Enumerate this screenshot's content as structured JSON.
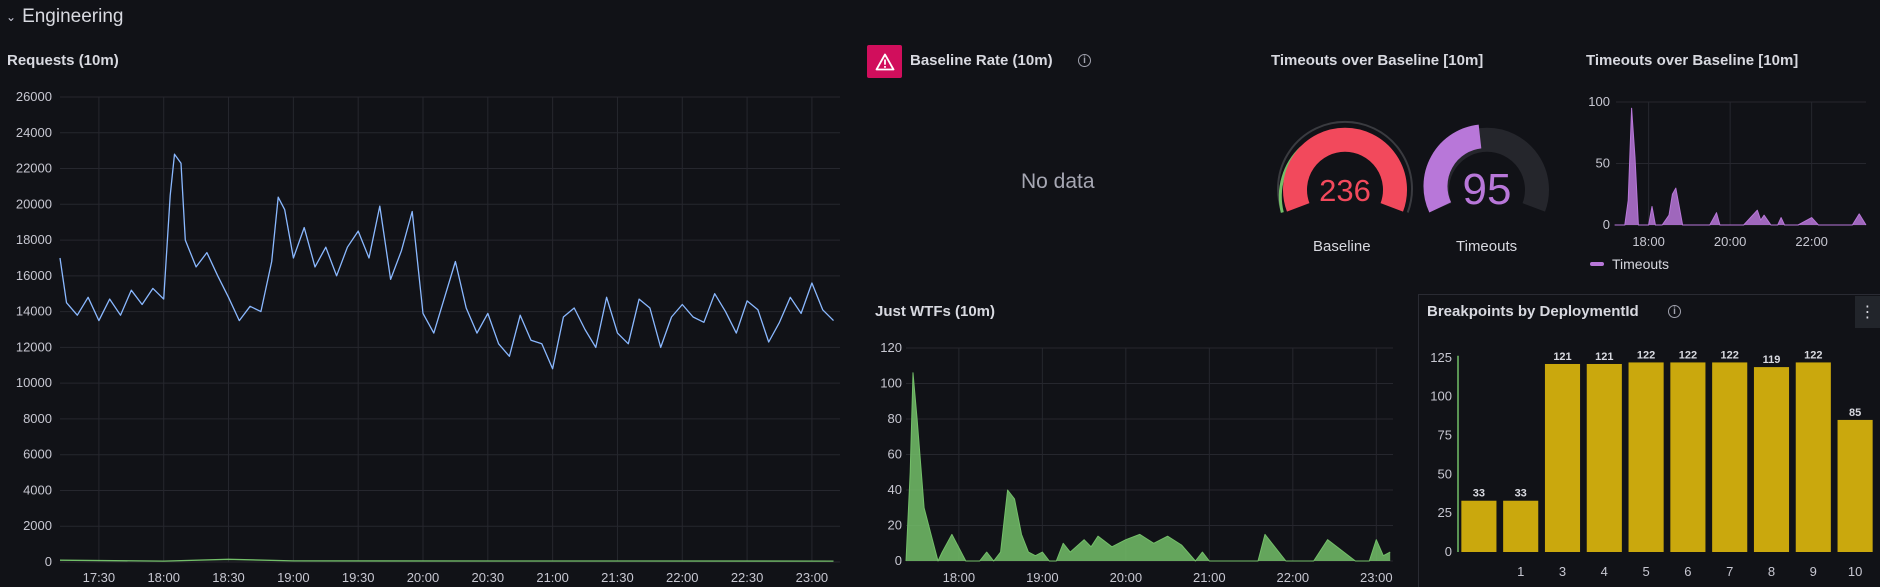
{
  "row": {
    "chevron": "⌄",
    "title": "Engineering"
  },
  "colors": {
    "background": "#111217",
    "line_blue": "#8ab8ff",
    "line_green": "#73bf69",
    "gauge_red": "#f2495c",
    "gauge_purple": "#b877d9",
    "bar_yellow": "#caa80d",
    "alert_pink": "#d10e5c"
  },
  "requests": {
    "title": "Requests (10m)",
    "chart_data": {
      "type": "line",
      "title": "Requests (10m)",
      "ylim": [
        0,
        26000
      ],
      "y_ticks": [
        "26000",
        "24000",
        "22000",
        "20000",
        "18000",
        "16000",
        "14000",
        "12000",
        "10000",
        "8000",
        "6000",
        "4000",
        "2000",
        "0"
      ],
      "x_ticks": [
        "17:30",
        "18:00",
        "18:30",
        "19:00",
        "19:30",
        "20:00",
        "20:30",
        "21:00",
        "21:30",
        "22:00",
        "22:30",
        "23:00"
      ],
      "series": [
        {
          "color": "#8ab8ff",
          "x": [
            "17:12",
            "17:15",
            "17:20",
            "17:25",
            "17:30",
            "17:35",
            "17:40",
            "17:45",
            "17:50",
            "17:55",
            "18:00",
            "18:03",
            "18:05",
            "18:08",
            "18:10",
            "18:15",
            "18:20",
            "18:25",
            "18:30",
            "18:35",
            "18:40",
            "18:45",
            "18:50",
            "18:53",
            "18:56",
            "19:00",
            "19:05",
            "19:10",
            "19:15",
            "19:20",
            "19:25",
            "19:30",
            "19:35",
            "19:40",
            "19:45",
            "19:50",
            "19:55",
            "20:00",
            "20:05",
            "20:10",
            "20:15",
            "20:20",
            "20:25",
            "20:30",
            "20:35",
            "20:40",
            "20:45",
            "20:50",
            "20:55",
            "21:00",
            "21:05",
            "21:10",
            "21:15",
            "21:20",
            "21:25",
            "21:30",
            "21:35",
            "21:40",
            "21:45",
            "21:50",
            "21:55",
            "22:00",
            "22:05",
            "22:10",
            "22:15",
            "22:20",
            "22:25",
            "22:30",
            "22:35",
            "22:40",
            "22:45",
            "22:50",
            "22:55",
            "23:00",
            "23:05",
            "23:10"
          ],
          "y": [
            17000,
            14500,
            13800,
            14800,
            13500,
            14700,
            13800,
            15200,
            14400,
            15300,
            14700,
            20500,
            22800,
            22300,
            18000,
            16500,
            17300,
            16000,
            14800,
            13500,
            14300,
            14000,
            16800,
            20400,
            19700,
            17000,
            18700,
            16500,
            17600,
            16000,
            17600,
            18500,
            17000,
            19900,
            15800,
            17400,
            19600,
            13900,
            12800,
            14800,
            16800,
            14200,
            12800,
            13900,
            12200,
            11500,
            13800,
            12400,
            12200,
            10800,
            13700,
            14200,
            13000,
            12000,
            14800,
            12800,
            12200,
            14700,
            14200,
            12000,
            13700,
            14400,
            13700,
            13400,
            15000,
            14000,
            12800,
            14600,
            14100,
            12300,
            13400,
            14800,
            13900,
            15600,
            14100,
            13500
          ]
        },
        {
          "color": "#73bf69",
          "x": [
            "17:12",
            "18:00",
            "18:30",
            "19:00",
            "23:10"
          ],
          "y": [
            100,
            50,
            150,
            60,
            50
          ]
        }
      ]
    }
  },
  "baseline": {
    "title": "Baseline Rate (10m)",
    "alert_icon": "warning-triangle-icon",
    "info_icon": "info-icon",
    "info_glyph": "i",
    "no_data": "No data"
  },
  "gauges": {
    "title": "Timeouts over Baseline [10m]",
    "chart_data": [
      {
        "type": "gauge",
        "label": "Baseline",
        "value": 236,
        "color": "#f2495c",
        "fill_fraction": 1.0
      },
      {
        "type": "gauge",
        "label": "Timeouts",
        "value": 95,
        "color": "#b877d9",
        "fill_fraction": 0.4
      }
    ]
  },
  "timeouts": {
    "title": "Timeouts over Baseline [10m]",
    "legend": "Timeouts",
    "chart_data": {
      "type": "area",
      "ylim": [
        0,
        100
      ],
      "y_ticks": [
        "100",
        "50",
        "0"
      ],
      "x_ticks": [
        "18:00",
        "20:00",
        "22:00"
      ],
      "series": [
        {
          "name": "Timeouts",
          "color": "#b877d9",
          "x": [
            "17:10",
            "17:25",
            "17:30",
            "17:35",
            "17:40",
            "17:45",
            "17:50",
            "17:55",
            "18:00",
            "18:05",
            "18:10",
            "18:20",
            "18:30",
            "18:35",
            "18:40",
            "18:45",
            "18:50",
            "19:00",
            "19:30",
            "19:40",
            "19:45",
            "20:00",
            "20:20",
            "20:30",
            "20:40",
            "20:45",
            "20:50",
            "21:00",
            "21:10",
            "21:15",
            "21:20",
            "21:30",
            "21:40",
            "22:00",
            "22:10",
            "22:20",
            "22:30",
            "22:40",
            "23:00",
            "23:10",
            "23:20"
          ],
          "y": [
            0,
            0,
            20,
            95,
            55,
            0,
            0,
            0,
            0,
            15,
            0,
            0,
            8,
            25,
            30,
            15,
            0,
            0,
            0,
            10,
            0,
            0,
            0,
            6,
            12,
            4,
            8,
            0,
            0,
            6,
            0,
            0,
            0,
            6,
            0,
            0,
            0,
            0,
            0,
            9,
            0
          ]
        }
      ]
    }
  },
  "wtfs": {
    "title": "Just WTFs (10m)",
    "chart_data": {
      "type": "area",
      "ylim": [
        0,
        120
      ],
      "y_ticks": [
        "120",
        "100",
        "80",
        "60",
        "40",
        "20",
        "0"
      ],
      "x_ticks": [
        "18:00",
        "19:00",
        "20:00",
        "21:00",
        "22:00",
        "23:00"
      ],
      "series": [
        {
          "color": "#73bf69",
          "x": [
            "17:22",
            "17:25",
            "17:27",
            "17:30",
            "17:32",
            "17:35",
            "17:40",
            "17:45",
            "17:48",
            "17:55",
            "18:05",
            "18:15",
            "18:20",
            "18:25",
            "18:30",
            "18:35",
            "18:40",
            "18:45",
            "18:50",
            "18:55",
            "19:00",
            "19:05",
            "19:10",
            "19:15",
            "19:20",
            "19:30",
            "19:35",
            "19:40",
            "19:50",
            "20:00",
            "20:10",
            "20:20",
            "20:30",
            "20:40",
            "20:50",
            "20:55",
            "21:00",
            "21:10",
            "21:25",
            "21:35",
            "21:40",
            "21:55",
            "22:00",
            "22:15",
            "22:25",
            "22:45",
            "22:55",
            "23:00",
            "23:05",
            "23:10"
          ],
          "y": [
            0,
            50,
            106,
            80,
            60,
            30,
            15,
            0,
            5,
            15,
            0,
            0,
            5,
            0,
            5,
            40,
            35,
            15,
            5,
            3,
            5,
            0,
            0,
            10,
            5,
            12,
            8,
            14,
            8,
            12,
            15,
            10,
            14,
            9,
            0,
            5,
            0,
            0,
            0,
            0,
            15,
            0,
            0,
            0,
            12,
            0,
            0,
            12,
            3,
            5
          ]
        }
      ]
    }
  },
  "breakpoints": {
    "title": "Breakpoints by DeploymentId",
    "info_icon": "info-icon",
    "info_glyph": "i",
    "menu_icon": "kebab-menu-icon",
    "menu_glyph": "⋮",
    "chart_data": {
      "type": "bar",
      "ylim": [
        0,
        130
      ],
      "y_ticks": [
        "125",
        "100",
        "75",
        "50",
        "25",
        "0"
      ],
      "categories": [
        "",
        "1",
        "3",
        "4",
        "5",
        "6",
        "7",
        "8",
        "9",
        "10"
      ],
      "values": [
        33,
        33,
        121,
        121,
        122,
        122,
        122,
        119,
        122,
        85
      ],
      "data_labels": [
        "33",
        "33",
        "121",
        "121",
        "122",
        "122",
        "122",
        "119",
        "122",
        "85"
      ],
      "color": "#caa80d"
    }
  }
}
